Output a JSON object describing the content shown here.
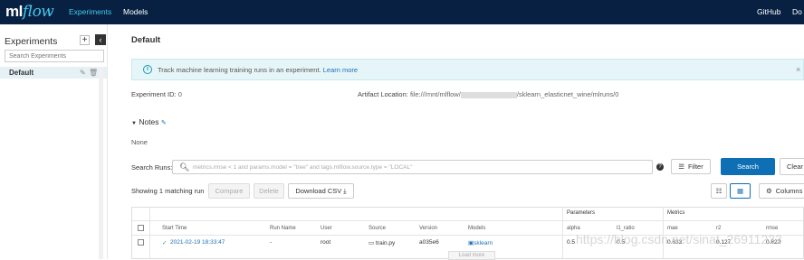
{
  "header": {
    "logo_ml": "ml",
    "logo_flow": "flow",
    "nav": [
      "Experiments",
      "Models"
    ],
    "right": [
      "GitHub",
      "Do"
    ]
  },
  "sidebar": {
    "title": "Experiments",
    "search_placeholder": "Search Experiments",
    "items": [
      {
        "label": "Default"
      }
    ]
  },
  "main": {
    "title": "Default",
    "banner": {
      "text": "Track machine learning training runs in an experiment.",
      "link": "Learn more"
    },
    "experiment_id_label": "Experiment ID:",
    "experiment_id": "0",
    "artifact_label": "Artifact Location:",
    "artifact_prefix": "file:///mnt/mlflow/",
    "artifact_suffix": "/sklearn_elasticnet_wine/mlruns/0",
    "notes_label": "Notes",
    "notes_value": "None",
    "search_label": "Search Runs:",
    "search_placeholder": "metrics.rmse < 1 and params.model = \"tree\" and tags.mlflow.source.type = \"LOCAL\"",
    "filter_label": "Filter",
    "search_button": "Search",
    "clear_button": "Clear",
    "matching": "Showing 1 matching run",
    "compare": "Compare",
    "delete": "Delete",
    "download": "Download CSV",
    "columns": "Columns"
  },
  "table": {
    "group_params": "Parameters",
    "group_metrics": "Metrics",
    "headers": [
      "Start Time",
      "Run Name",
      "User",
      "Source",
      "Version",
      "Models",
      "alpha",
      "l1_ratio",
      "mae",
      "r2",
      "rmse"
    ],
    "row": [
      "2021-02-19 18:33:47",
      "-",
      "root",
      "train.py",
      "a035e6",
      "sklearn",
      "0.5",
      "0.5",
      "0.633",
      "0.127",
      "0.822"
    ],
    "load_more": "Load more"
  },
  "watermark": "https://blog.csdn.net/sinat_26911233"
}
